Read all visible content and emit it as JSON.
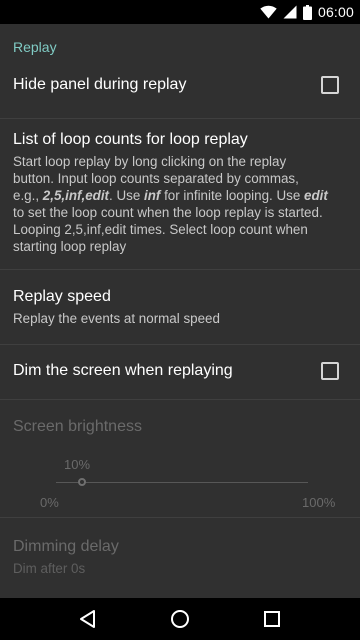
{
  "status_bar": {
    "time": "06:00",
    "icons": [
      "wifi-icon",
      "signal-icon",
      "battery-icon"
    ]
  },
  "category": {
    "title": "Replay",
    "color": "#80cbc4"
  },
  "prefs": {
    "hide_panel": {
      "title": "Hide panel during replay",
      "checked": false
    },
    "loop_counts": {
      "title": "List of loop counts for loop replay",
      "summary_lines": [
        "Start loop replay by long clicking on the replay",
        "button. Input loop counts separated by commas,",
        "e.g., ",
        "2,5,inf,edit",
        ". Use ",
        "inf",
        " for infinite looping. Use ",
        "edit",
        "to set the loop count when the loop replay is started.",
        "Looping 2,5,inf,edit times. Select loop count when",
        "starting loop replay"
      ]
    },
    "replay_speed": {
      "title": "Replay speed",
      "summary": "Replay the events at normal speed"
    },
    "dim_screen": {
      "title": "Dim the screen when replaying",
      "checked": false
    },
    "screen_brightness": {
      "title": "Screen brightness",
      "value_label": "10%",
      "min_label": "0%",
      "max_label": "100%",
      "value": 0.1,
      "enabled": false
    },
    "dimming_delay": {
      "title": "Dimming delay",
      "summary": "Dim after 0s",
      "enabled": false
    }
  },
  "nav_bar": {
    "buttons": [
      "back-icon",
      "home-icon",
      "recents-icon"
    ]
  }
}
